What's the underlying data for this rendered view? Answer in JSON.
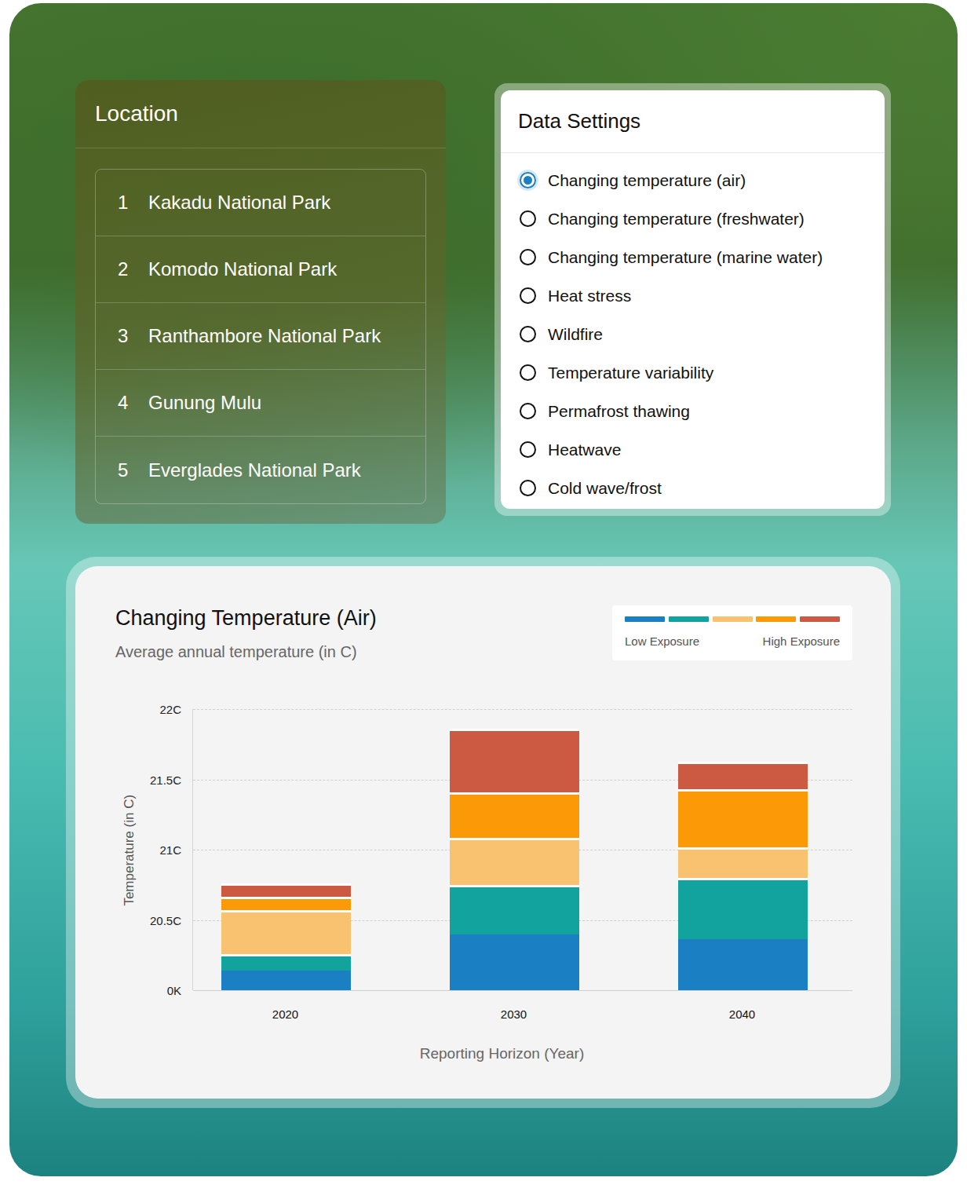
{
  "location": {
    "title": "Location",
    "items": [
      {
        "number": "1",
        "name": "Kakadu National Park"
      },
      {
        "number": "2",
        "name": "Komodo National Park"
      },
      {
        "number": "3",
        "name": "Ranthambore National Park"
      },
      {
        "number": "4",
        "name": "Gunung Mulu"
      },
      {
        "number": "5",
        "name": "Everglades National Park"
      }
    ]
  },
  "data_settings": {
    "title": "Data Settings",
    "options": [
      {
        "label": "Changing temperature (air)",
        "selected": true
      },
      {
        "label": "Changing temperature (freshwater)",
        "selected": false
      },
      {
        "label": "Changing temperature (marine water)",
        "selected": false
      },
      {
        "label": "Heat stress",
        "selected": false
      },
      {
        "label": "Wildfire",
        "selected": false
      },
      {
        "label": "Temperature variability",
        "selected": false
      },
      {
        "label": "Permafrost thawing",
        "selected": false
      },
      {
        "label": "Heatwave",
        "selected": false
      },
      {
        "label": "Cold wave/frost",
        "selected": false
      }
    ]
  },
  "chart": {
    "title": "Changing Temperature (Air)",
    "subtitle": "Average annual temperature (in C)",
    "legend": {
      "low_label": "Low Exposure",
      "high_label": "High Exposure"
    },
    "y_axis": {
      "title": "Temperature (in C)",
      "min": 20,
      "max": 22,
      "ticks": [
        "22C",
        "21.5C",
        "21C",
        "20.5C",
        "0K"
      ]
    },
    "x_axis": {
      "title": "Reporting Horizon (Year)",
      "categories": [
        "2020",
        "2030",
        "2040"
      ]
    },
    "series": [
      {
        "color": "#1a7fc3",
        "values": [
          0.14,
          0.4,
          0.365
        ]
      },
      {
        "color": "#12a39f",
        "values": [
          0.12,
          0.35,
          0.435
        ]
      },
      {
        "color": "#f9c270",
        "values": [
          0.31,
          0.335,
          0.22
        ]
      },
      {
        "color": "#fb9a06",
        "values": [
          0.095,
          0.325,
          0.41
        ]
      },
      {
        "color": "#cc5a42",
        "values": [
          0.1,
          0.45,
          0.2
        ]
      }
    ]
  }
}
